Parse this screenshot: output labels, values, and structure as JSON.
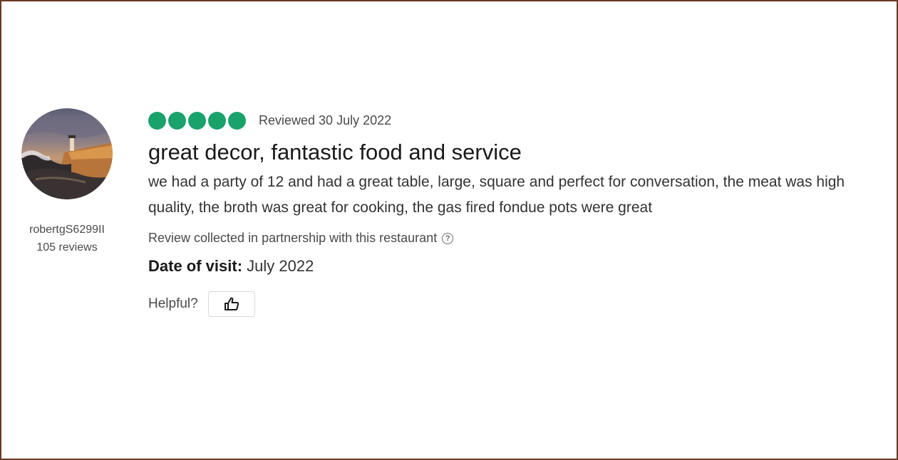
{
  "reviewer": {
    "name": "robertgS6299II",
    "review_count": "105 reviews"
  },
  "review": {
    "rating": 5,
    "reviewed_date": "Reviewed 30 July 2022",
    "title": "great decor, fantastic food and service",
    "body": "we had a party of 12 and had a great table, large, square and perfect for conversation, the meat was high quality, the broth was great for cooking, the gas fired fondue pots were great",
    "collected_note": "Review collected in partnership with this restaurant",
    "visit_label": "Date of visit:",
    "visit_value": "July 2022",
    "helpful_label": "Helpful?"
  },
  "icons": {
    "help": "question-circle-icon",
    "thumb": "thumbs-up-icon"
  },
  "colors": {
    "rating_bubble": "#1aa26b",
    "frame_border": "#6b3a22"
  }
}
